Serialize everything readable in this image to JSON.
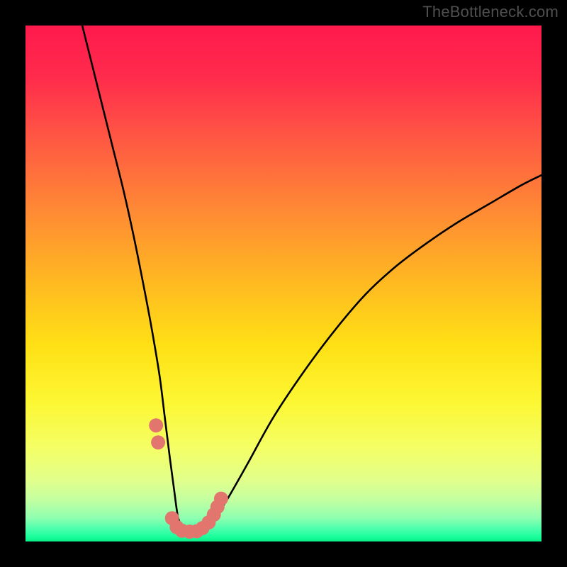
{
  "watermark": "TheBottleneck.com",
  "chart_data": {
    "type": "line",
    "title": "",
    "xlabel": "",
    "ylabel": "",
    "xlim": [
      0,
      100
    ],
    "ylim": [
      0,
      100
    ],
    "grid": false,
    "series": [
      {
        "name": "bottleneck-curve",
        "x": [
          11,
          13,
          15,
          17,
          19,
          21,
          23,
          24.5,
          26,
          27,
          28,
          28.8,
          29.5,
          30.2,
          31,
          31.8,
          33,
          34.5,
          36.5,
          39,
          43,
          48,
          54,
          60,
          66,
          72,
          78,
          84,
          90,
          96,
          100
        ],
        "y": [
          100,
          92,
          84,
          76,
          68,
          59,
          49,
          41,
          32,
          24,
          16,
          10,
          5,
          3,
          1.7,
          1.5,
          1.6,
          2.2,
          4.2,
          8,
          15,
          24,
          33,
          41,
          48,
          53.5,
          58,
          62,
          65.5,
          69,
          71
        ]
      }
    ],
    "annotations": [
      {
        "name": "accent-blobs",
        "color": "#e2766e",
        "points_xy": [
          [
            25.3,
            22.5
          ],
          [
            25.7,
            19.2
          ],
          [
            28.4,
            4.5
          ],
          [
            29.3,
            2.8
          ],
          [
            30.3,
            2.1
          ],
          [
            31.8,
            1.9
          ],
          [
            33.2,
            2.0
          ],
          [
            34.3,
            2.6
          ],
          [
            35.5,
            3.7
          ],
          [
            36.5,
            5.2
          ],
          [
            37.2,
            6.7
          ],
          [
            37.9,
            8.3
          ]
        ],
        "radius_px": 10
      }
    ],
    "background_gradient": {
      "stops": [
        {
          "pos": 0.0,
          "color": "#ff1a4d"
        },
        {
          "pos": 0.1,
          "color": "#ff2b4c"
        },
        {
          "pos": 0.22,
          "color": "#ff5843"
        },
        {
          "pos": 0.36,
          "color": "#ff8a34"
        },
        {
          "pos": 0.5,
          "color": "#ffba21"
        },
        {
          "pos": 0.62,
          "color": "#ffe015"
        },
        {
          "pos": 0.73,
          "color": "#fcf733"
        },
        {
          "pos": 0.82,
          "color": "#f4ff66"
        },
        {
          "pos": 0.88,
          "color": "#e2ff8a"
        },
        {
          "pos": 0.92,
          "color": "#c3ffa1"
        },
        {
          "pos": 0.955,
          "color": "#8dffb0"
        },
        {
          "pos": 0.975,
          "color": "#4dffad"
        },
        {
          "pos": 0.99,
          "color": "#1dff9c"
        },
        {
          "pos": 1.0,
          "color": "#08f08a"
        }
      ]
    }
  }
}
